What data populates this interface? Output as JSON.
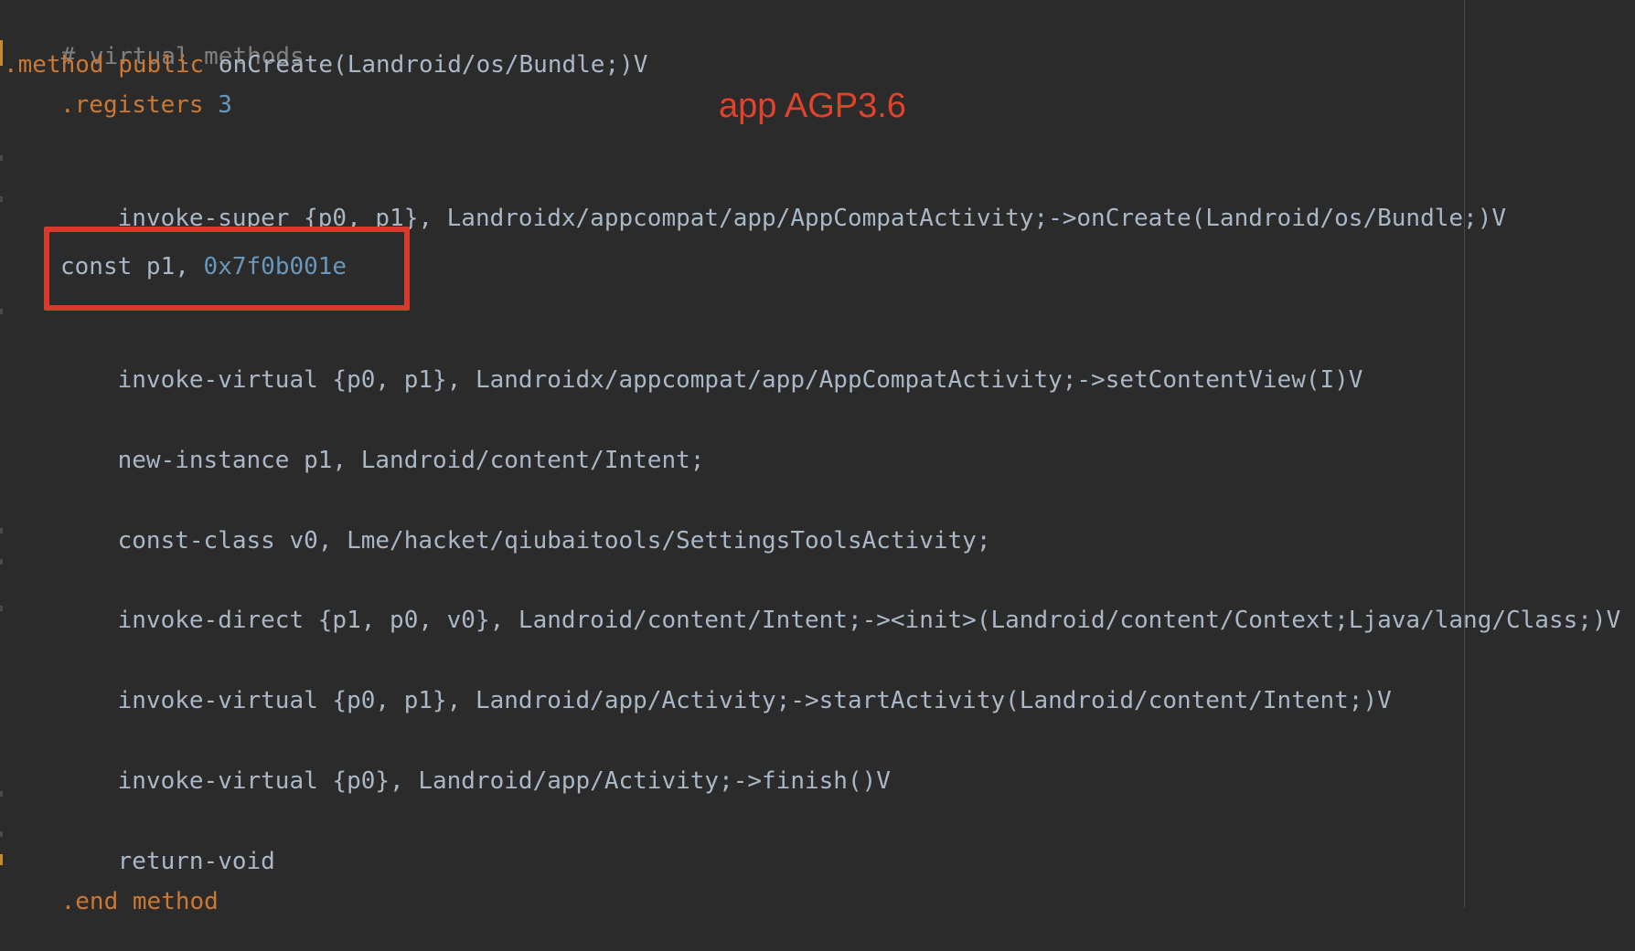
{
  "annotation": {
    "label": "app AGP3.6",
    "color": "#e0432b",
    "highlight_color": "#d63a2a"
  },
  "colors": {
    "background": "#2b2b2b",
    "keyword": "#cc7832",
    "number": "#6897bb",
    "comment": "#808080",
    "text": "#a9b7c6"
  },
  "code": {
    "comment": "# virtual methods",
    "method_decl": {
      "kw1": ".method",
      "kw2": "public",
      "sig": "onCreate(Landroid/os/Bundle;)V"
    },
    "registers": {
      "kw": ".registers",
      "value": "3"
    },
    "invoke_super": "invoke-super {p0, p1}, Landroidx/appcompat/app/AppCompatActivity;->onCreate(Landroid/os/Bundle;)V",
    "const_line": {
      "text": "const p1, ",
      "value": "0x7f0b001e"
    },
    "set_content_view": "invoke-virtual {p0, p1}, Landroidx/appcompat/app/AppCompatActivity;->setContentView(I)V",
    "new_instance": "new-instance p1, Landroid/content/Intent;",
    "const_class": "const-class v0, Lme/hacket/qiubaitools/SettingsToolsActivity;",
    "invoke_direct": "invoke-direct {p1, p0, v0}, Landroid/content/Intent;-><init>(Landroid/content/Context;Ljava/lang/Class;)V",
    "start_activity": "invoke-virtual {p0, p1}, Landroid/app/Activity;->startActivity(Landroid/content/Intent;)V",
    "finish": "invoke-virtual {p0}, Landroid/app/Activity;->finish()V",
    "return_void": "return-void",
    "end_method": ".end method"
  }
}
